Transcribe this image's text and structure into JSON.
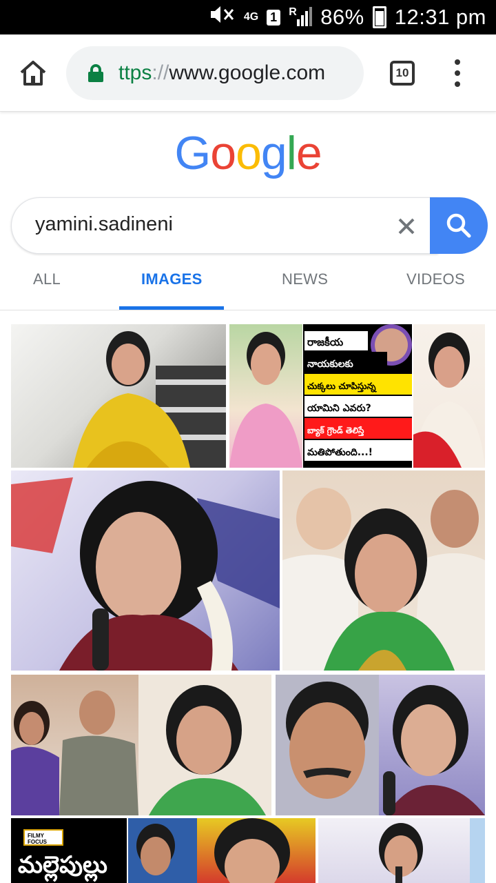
{
  "status_bar": {
    "network": "4G",
    "sim": "1",
    "roaming": "R",
    "battery": "86%",
    "time": "12:31 pm",
    "icons": [
      "mute-icon",
      "network-4g-icon",
      "sim-icon",
      "signal-icon",
      "battery-icon"
    ]
  },
  "browser": {
    "url_scheme": "ttps",
    "url_sep": "://",
    "url_host": "www.google.com",
    "tab_count": "10",
    "icons": [
      "home-icon",
      "lock-icon",
      "tabs-icon",
      "menu-icon"
    ]
  },
  "search": {
    "logo_letters": [
      "G",
      "o",
      "o",
      "g",
      "l",
      "e"
    ],
    "logo_colors": [
      "#4285f4",
      "#ea4335",
      "#fbbc05",
      "#4285f4",
      "#34a853",
      "#ea4335"
    ],
    "query": "yamini.sadineni",
    "icons": [
      "clear-icon",
      "search-icon"
    ]
  },
  "tabs": [
    {
      "label": "ALL",
      "active": false
    },
    {
      "label": "IMAGES",
      "active": true
    },
    {
      "label": "NEWS",
      "active": false
    },
    {
      "label": "VIDEOS",
      "active": false
    }
  ],
  "accent_color": "#1a73e8",
  "results": {
    "tile2_caption_lines": [
      "రాజకీయ",
      "నాయకులకు",
      "చుక్కలు చూపిస్తున్న",
      "యామిని ఎవరు?",
      "బ్యాక్ గ్రౌండ్ తెలిస్తే",
      "మతిపోతుంది...!"
    ],
    "tile9_badge": "FILMY FOCUS",
    "tile9_caption": "మల్లెపుల్లు"
  }
}
